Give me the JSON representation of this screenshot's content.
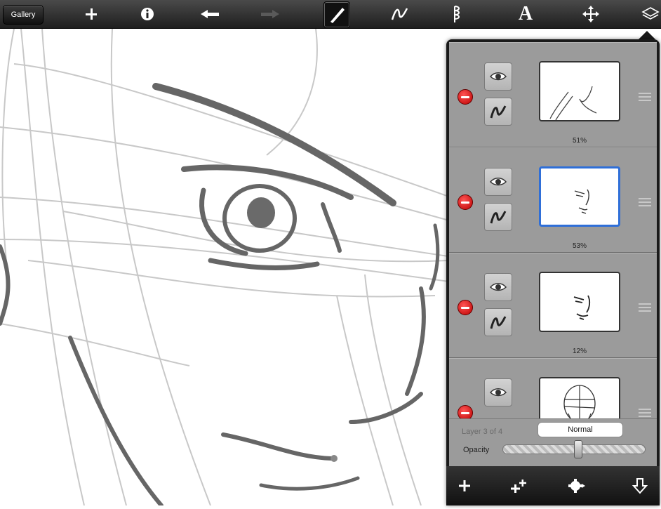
{
  "toolbar": {
    "gallery_label": "Gallery",
    "icons": [
      "plus-icon",
      "info-icon",
      "undo-icon",
      "redo-icon",
      "brush-icon",
      "stroke-icon",
      "smudge-icon",
      "text-icon",
      "move-icon",
      "layers-icon"
    ],
    "selected_tool": "brush-icon",
    "text_tool_glyph": "A"
  },
  "layers_panel": {
    "layers": [
      {
        "opacity_label": "51%",
        "selected": false
      },
      {
        "opacity_label": "53%",
        "selected": true
      },
      {
        "opacity_label": "12%",
        "selected": false
      },
      {
        "opacity_label": "",
        "selected": false
      }
    ],
    "layer_count": "Layer 3 of 4",
    "blend_mode": "Normal",
    "opacity_label": "Opacity",
    "opacity_value": 0.53,
    "bottom_icons": [
      "add-layer-icon",
      "duplicate-layer-icon",
      "layer-settings-icon",
      "merge-down-icon"
    ]
  },
  "colors": {
    "accent": "#2f6fd8",
    "delete": "#d01818",
    "panel_bg": "#9b9b9b"
  }
}
